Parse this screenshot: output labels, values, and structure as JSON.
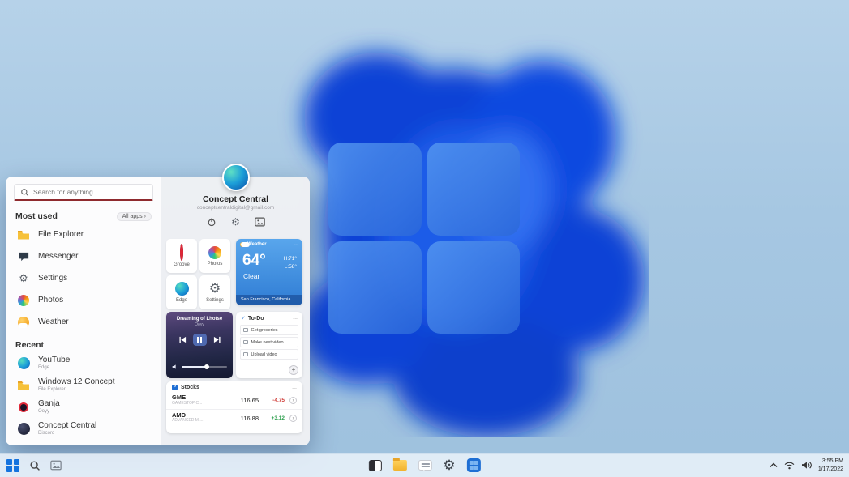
{
  "wallpaper": {
    "accent": "#0a43d6"
  },
  "start_menu": {
    "search": {
      "placeholder": "Search for anything"
    },
    "most_used": {
      "title": "Most used",
      "all_apps_label": "All apps",
      "all_apps_chevron": "›",
      "items": [
        {
          "name": "File Explorer"
        },
        {
          "name": "Messenger"
        },
        {
          "name": "Settings"
        },
        {
          "name": "Photos"
        },
        {
          "name": "Weather"
        }
      ]
    },
    "recent": {
      "title": "Recent",
      "items": [
        {
          "name": "YouTube",
          "app": "Edge"
        },
        {
          "name": "Windows 12 Concept",
          "app": "File Explorer"
        },
        {
          "name": "Ganja",
          "app": "Ooyy"
        },
        {
          "name": "Concept Central",
          "app": "Discord"
        }
      ]
    },
    "profile": {
      "name": "Concept Central",
      "email": "conceptcentraldigital@gmail.com"
    },
    "tiles": [
      {
        "label": "Groove"
      },
      {
        "label": "Photos"
      },
      {
        "label": "Edge"
      },
      {
        "label": "Settings"
      }
    ],
    "widgets": {
      "weather": {
        "title": "Weather",
        "menu": "...",
        "temperature": "64°",
        "condition": "Clear",
        "high": "H:71°",
        "low": "L:58°",
        "location": "San Francisco, California"
      },
      "music": {
        "track": "Dreaming of Lhotse",
        "artist": "Ooyy"
      },
      "todo": {
        "title": "To-Do",
        "check": "✓",
        "menu": "...",
        "items": [
          "Get groceries",
          "Make next video",
          "Upload video"
        ],
        "add_label": "+"
      },
      "stocks": {
        "title": "Stocks",
        "icon_glyph": "↗",
        "menu": "...",
        "rows": [
          {
            "symbol": "GME",
            "company": "GAMESTOP C...",
            "price": "116.65",
            "change": "-4.75",
            "direction": "down",
            "go": "›"
          },
          {
            "symbol": "AMD",
            "company": "ADVANCED MI...",
            "price": "116.88",
            "change": "+3.12",
            "direction": "up",
            "go": "›"
          }
        ]
      }
    }
  },
  "taskbar": {
    "tray": {
      "time": "3:55 PM",
      "date": "1/17/2022"
    }
  }
}
